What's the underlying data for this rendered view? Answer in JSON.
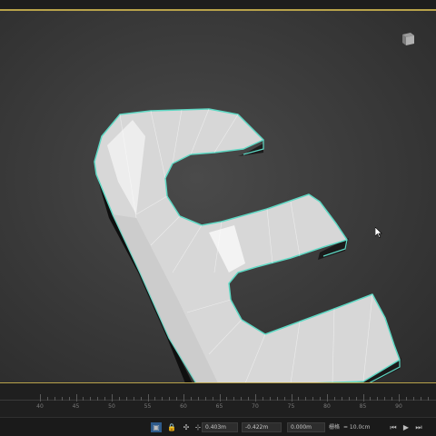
{
  "viewport": {
    "label": "3D viewport",
    "viewcube_icon": "viewcube-icon",
    "model_icon": "e-letter-mesh"
  },
  "timeline": {
    "labels": [
      "40",
      "45",
      "50",
      "55",
      "60",
      "65",
      "70",
      "75",
      "80",
      "85",
      "90"
    ]
  },
  "statusbar": {
    "x_value": "0.403m",
    "y_value": "-0.422m",
    "z_value": "0.000m",
    "grid_label": "栅格",
    "grid_value": "= 10.0cm",
    "icons": [
      "selection-lock-icon",
      "lock-icon",
      "snap-icon",
      "coordinate-mode-icon",
      "goto-start-icon",
      "play-icon",
      "goto-end-icon"
    ]
  },
  "colors": {
    "accent": "#b8a24a",
    "selection": "#5fd8c4",
    "mesh": "#d9d9d9"
  }
}
